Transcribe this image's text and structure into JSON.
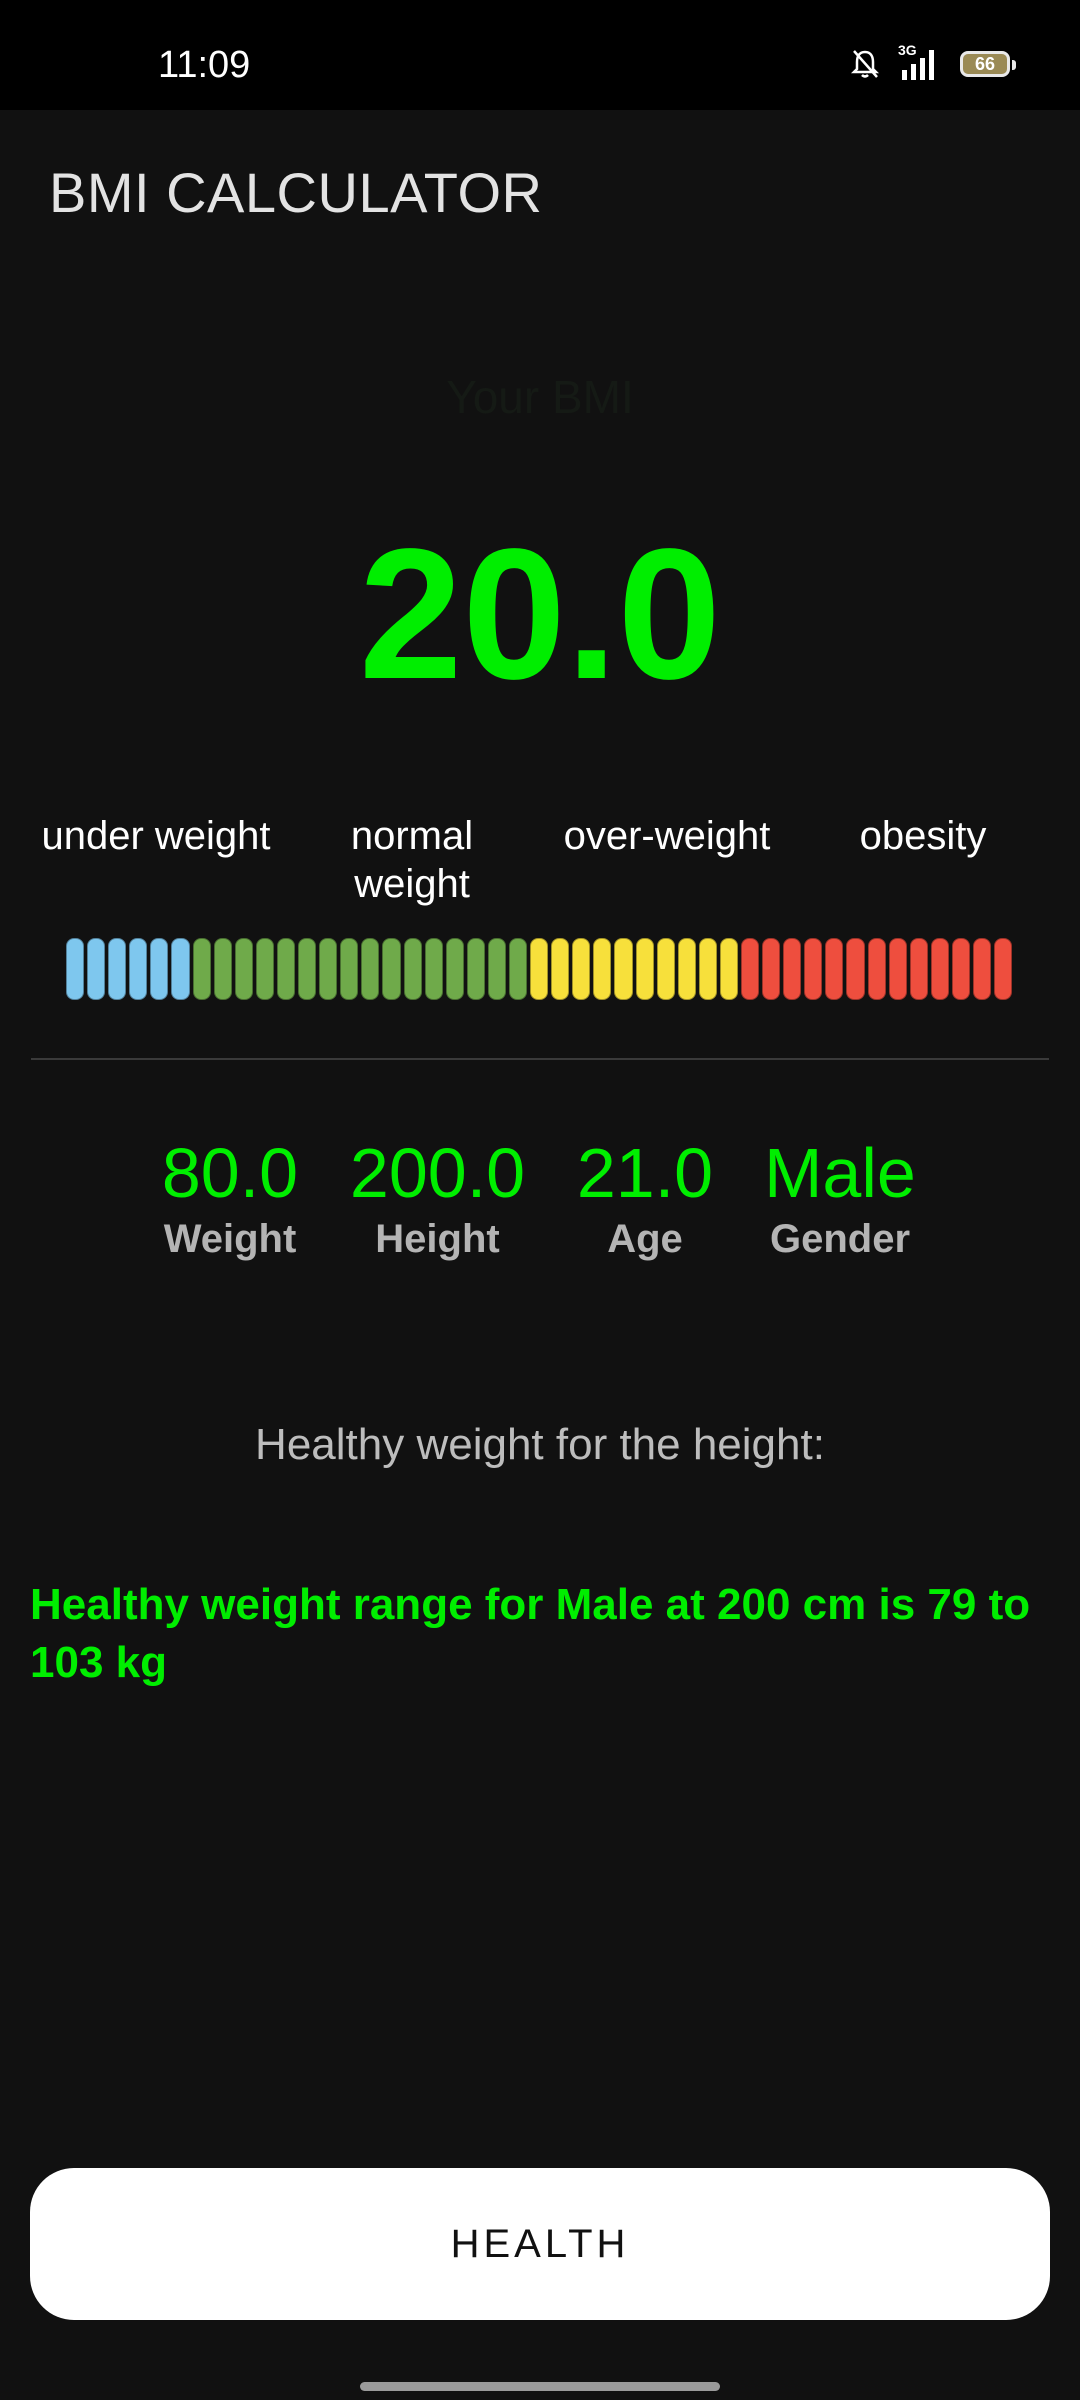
{
  "status_bar": {
    "time": "11:09",
    "network": "3G",
    "battery": "66"
  },
  "app": {
    "title": "BMI CALCULATOR"
  },
  "bmi": {
    "heading": "Your BMI",
    "value": "20.0"
  },
  "categories": {
    "under": "under weight",
    "normal": "normal weight",
    "over": "over-weight",
    "obesity": "obesity"
  },
  "scale": {
    "colors": {
      "under": "#7ec7ee",
      "normal": "#6faa4a",
      "over": "#f7e03b",
      "obesity": "#ee4e3e"
    }
  },
  "stats": {
    "weight": {
      "value": "80.0",
      "label": "Weight"
    },
    "height": {
      "value": "200.0",
      "label": "Height"
    },
    "age": {
      "value": "21.0",
      "label": "Age"
    },
    "gender": {
      "value": "Male",
      "label": "Gender"
    }
  },
  "healthy": {
    "heading": "Healthy weight for the height:",
    "range_text": "Healthy weight range for Male at 200 cm is 79 to 103 kg"
  },
  "actions": {
    "health_label": "HEALTH"
  },
  "colors": {
    "accent": "#00ee00",
    "background": "#111111"
  }
}
